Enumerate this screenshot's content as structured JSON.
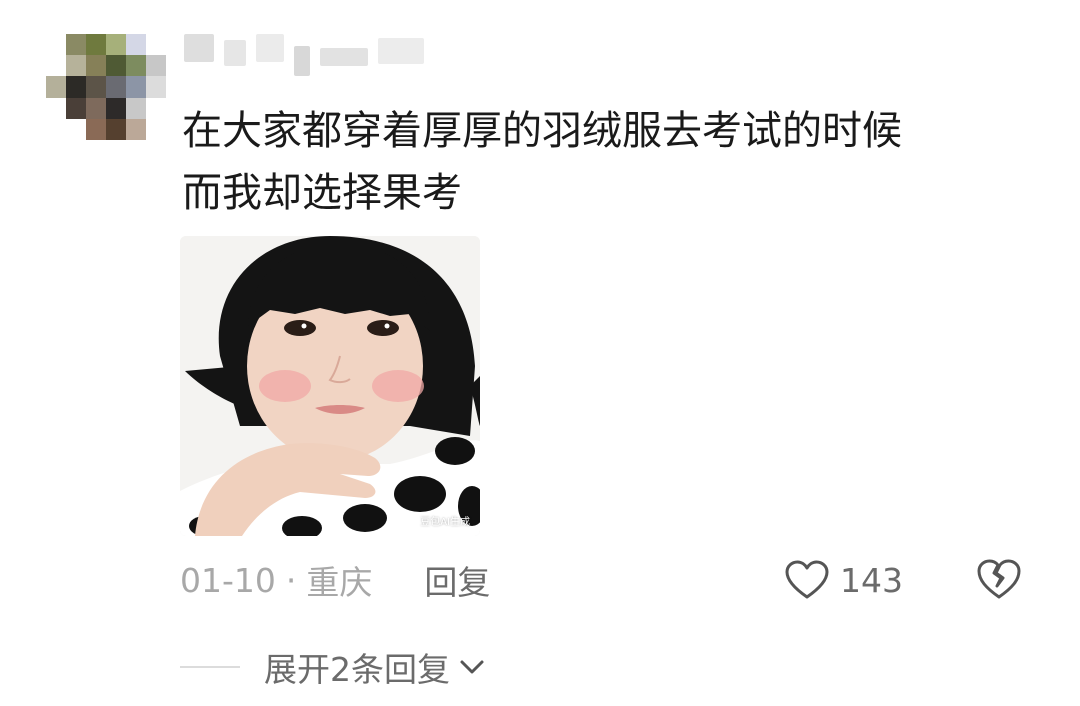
{
  "comment": {
    "text_line1": "在大家都穿着厚厚的羽绒服去考试的时候",
    "text_line2": "而我却选择果考",
    "image_watermark": "豆包AI生成",
    "date": "01-10",
    "separator": "·",
    "location": "重庆",
    "reply_label": "回复",
    "like_count": "143",
    "expand_label": "展开2条回复"
  },
  "icons": {
    "like": "heart-outline-icon",
    "dislike": "broken-heart-icon",
    "expand": "chevron-down-icon"
  },
  "colors": {
    "text_primary": "#1a1a1a",
    "text_secondary": "#6b6b6b",
    "text_muted": "#a8a8a8"
  }
}
